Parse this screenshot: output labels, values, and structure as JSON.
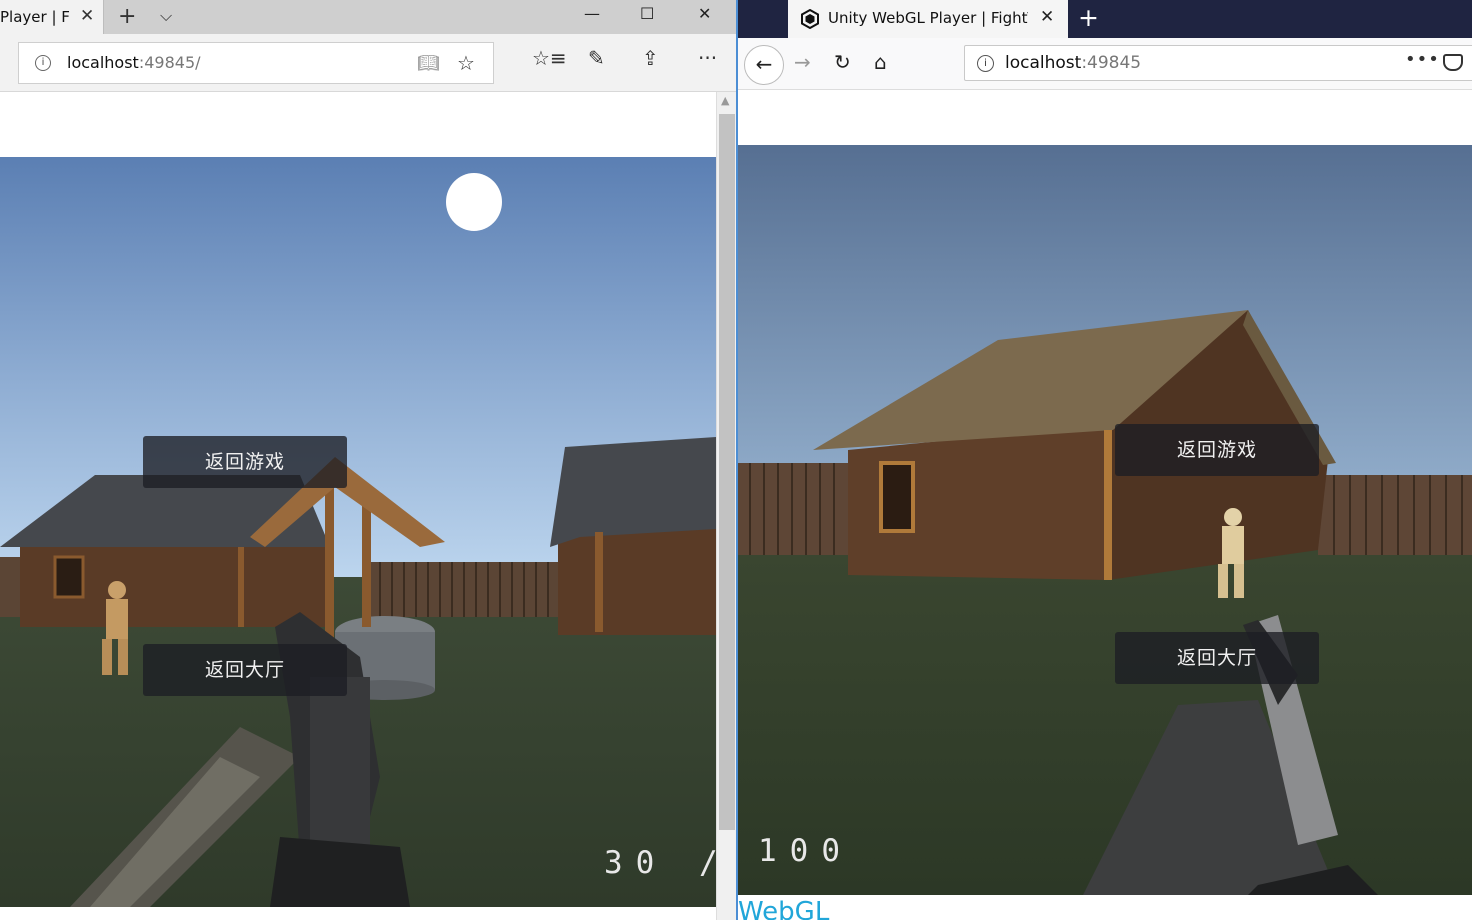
{
  "left_window": {
    "tab_title": "Player | Fig",
    "address": {
      "host": "localhost",
      "port": ":49845/"
    },
    "icons": [
      "info-icon",
      "reading-view-icon",
      "favorite-star-icon",
      "favorites-hub-icon",
      "web-note-icon",
      "share-icon",
      "more-icon"
    ],
    "window_controls": {
      "minimize": "—",
      "maximize": "☐",
      "close": "✕"
    },
    "game": {
      "menu": {
        "resume": "返回游戏",
        "lobby": "返回大厅"
      },
      "ammo": {
        "current": "30",
        "separator": "/"
      }
    }
  },
  "right_window": {
    "tab_title": "Unity WebGL Player | FightTo",
    "address": {
      "host": "localhost",
      "port": ":49845"
    },
    "icons": [
      "unity-favicon-icon",
      "back-arrow-icon",
      "forward-arrow-icon",
      "reload-icon",
      "home-icon",
      "info-icon",
      "page-actions-icon",
      "pocket-icon"
    ],
    "game": {
      "menu": {
        "resume": "返回游戏",
        "lobby": "返回大厅"
      },
      "ammo": {
        "reserve": "100"
      }
    },
    "footer_logo": "WebGL"
  },
  "colors": {
    "sky_top": "#5b7fb3",
    "sky_bottom": "#b7d3ec",
    "ground": "#3b4733",
    "wood": "#5a3b26",
    "roof": "#4a4d52",
    "firefox_tabbar": "#1f2441",
    "edge_tabbar": "#cfcfcf",
    "webgl_blue": "#21a6d9"
  }
}
